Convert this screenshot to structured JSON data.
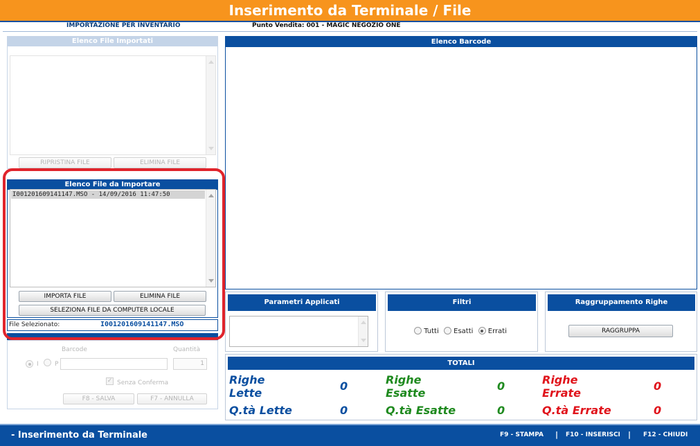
{
  "window": {
    "title": "Inserimento da Terminale / File"
  },
  "info": {
    "mode": "IMPORTAZIONE PER INVENTARIO",
    "store": "Punto Vendita: 001 - MAGIC NEGOZIO ONE"
  },
  "imported_files": {
    "header": "Elenco File Importati",
    "restore_button": "RIPRISTINA FILE",
    "delete_button": "ELIMINA FILE"
  },
  "to_import": {
    "header": "Elenco File da Importare",
    "items": [
      "I001201609141147.MSO - 14/09/2016 11:47:50"
    ],
    "import_button": "IMPORTA FILE",
    "delete_button": "ELIMINA FILE",
    "select_local_button": "SELEZIONA FILE DA COMPUTER LOCALE",
    "selected_label": "File Selezionato:",
    "selected_value": "I001201609141147.MSO"
  },
  "manual": {
    "barcode_label": "Barcode",
    "quantity_label": "Quantità",
    "quantity_value": "1",
    "radio_i": "I",
    "radio_p": "P",
    "no_confirm_label": "Senza Conferma",
    "save_button": "F8 - SALVA",
    "cancel_button": "F7 - ANNULLA"
  },
  "barcode_list": {
    "header": "Elenco Barcode"
  },
  "params": {
    "header": "Parametri Applicati"
  },
  "filters": {
    "header": "Filtri",
    "all": "Tutti",
    "exact": "Esatti",
    "errors": "Errati",
    "selected": "Errati"
  },
  "grouping": {
    "header": "Raggruppamento Righe",
    "button": "RAGGRUPPA"
  },
  "totals": {
    "header": "TOTALI",
    "rows_read_label": "Righe Lette",
    "rows_read": "0",
    "rows_exact_label": "Righe Esatte",
    "rows_exact": "0",
    "rows_error_label": "Righe Errate",
    "rows_error": "0",
    "qty_read_label": "Q.tà Lette",
    "qty_read": "0",
    "qty_exact_label": "Q.tà Esatte",
    "qty_exact": "0",
    "qty_error_label": "Q.tà Errate",
    "qty_error": "0"
  },
  "colors": {
    "brand_orange": "#f7941d",
    "brand_blue": "#0a4fa0",
    "highlight_red": "#e0242c"
  },
  "footer": {
    "title": "- Inserimento da Terminale",
    "f9": "F9 - STAMPA",
    "f10": "F10 - INSERISCI",
    "f12": "F12 - CHIUDI",
    "sep": "|"
  }
}
